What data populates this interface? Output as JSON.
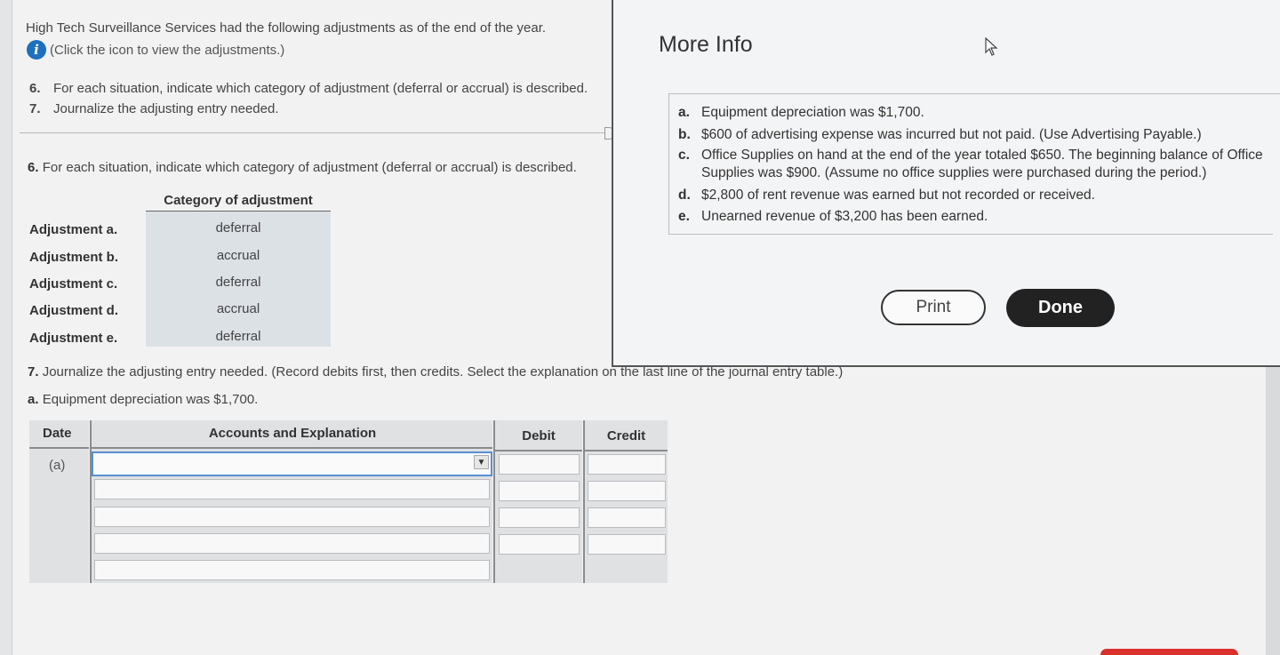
{
  "intro": {
    "text": "High Tech Surveillance Services had the following adjustments as of the end of the year.",
    "info_link": "(Click the icon to view the adjustments.)"
  },
  "steps": [
    {
      "num": "6.",
      "text": "For each situation, indicate which category of adjustment (deferral or accrual) is described."
    },
    {
      "num": "7.",
      "text": "Journalize the adjusting entry needed."
    }
  ],
  "q6": {
    "num": "6.",
    "text": "For each situation, indicate which category of adjustment (deferral or accrual) is described."
  },
  "category_table": {
    "header": "Category of adjustment",
    "rows": [
      {
        "label": "Adjustment a.",
        "value": "deferral"
      },
      {
        "label": "Adjustment b.",
        "value": "accrual"
      },
      {
        "label": "Adjustment c.",
        "value": "deferral"
      },
      {
        "label": "Adjustment d.",
        "value": "accrual"
      },
      {
        "label": "Adjustment e.",
        "value": "deferral"
      }
    ]
  },
  "q7": {
    "num": "7.",
    "text": "Journalize the adjusting entry needed. (Record debits first, then credits. Select the explanation on the last line of the journal entry table.)"
  },
  "adj_a": {
    "key": "a.",
    "text": "Equipment depreciation was $1,700."
  },
  "journal": {
    "headers": {
      "date": "Date",
      "accounts": "Accounts and Explanation",
      "debit": "Debit",
      "credit": "Credit"
    },
    "date_value": "(a)",
    "dropdown_glyph": "▼"
  },
  "modal": {
    "title": "More Info",
    "items": [
      {
        "key": "a.",
        "text": "Equipment depreciation was $1,700."
      },
      {
        "key": "b.",
        "text": "$600 of advertising expense was incurred but not paid. (Use Advertising Payable.)"
      },
      {
        "key": "c.",
        "text": "Office Supplies on hand at the end of the year totaled $650. The beginning balance of Office Supplies was $900. (Assume no office supplies were purchased during the period.)"
      },
      {
        "key": "d.",
        "text": "$2,800 of rent revenue was earned but not recorded or received."
      },
      {
        "key": "e.",
        "text": "Unearned revenue of $3,200 has been earned."
      }
    ],
    "print_label": "Print",
    "done_label": "Done"
  },
  "icons": {
    "info": "info-icon",
    "cursor": "mouse-pointer-icon",
    "dropdown": "chevron-down-icon"
  },
  "colors": {
    "info_icon": "#1f6fbf",
    "teal_bar": "#1a8a8a",
    "done_button": "#222222",
    "red_button": "#d9302e"
  }
}
